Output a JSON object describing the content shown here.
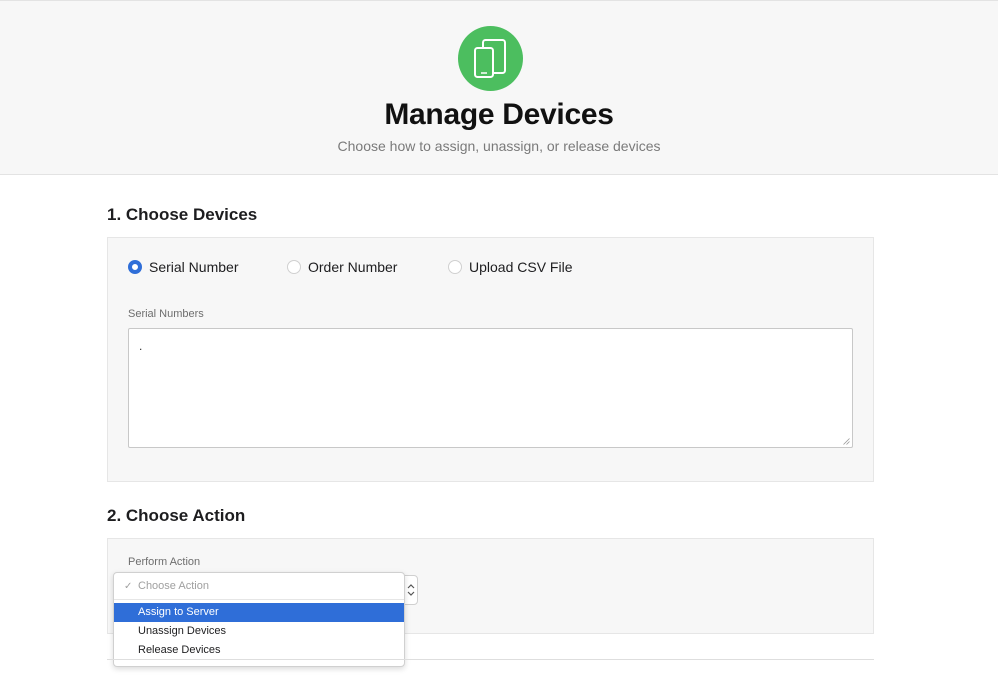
{
  "header": {
    "title": "Manage Devices",
    "subtitle": "Choose how to assign, unassign, or release devices",
    "icon": "devices-icon",
    "accent_color": "#4cbe5f"
  },
  "step1": {
    "heading": "1. Choose Devices",
    "options": [
      {
        "label": "Serial Number",
        "selected": true
      },
      {
        "label": "Order Number",
        "selected": false
      },
      {
        "label": "Upload CSV File",
        "selected": false
      }
    ],
    "field_label": "Serial Numbers",
    "field_value": "."
  },
  "step2": {
    "heading": "2. Choose Action",
    "field_label": "Perform Action",
    "dropdown": {
      "placeholder": "Choose Action",
      "items": [
        "Assign to Server",
        "Unassign Devices",
        "Release Devices"
      ],
      "highlighted": "Assign to Server"
    }
  },
  "colors": {
    "selection_blue": "#2f6ed8"
  }
}
